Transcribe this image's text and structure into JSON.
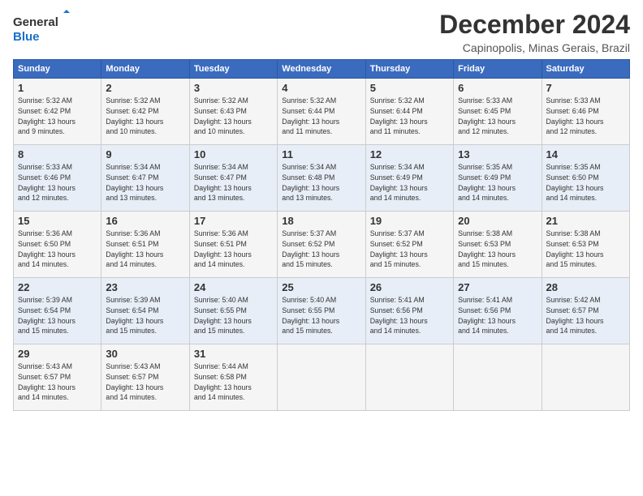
{
  "header": {
    "logo_line1": "General",
    "logo_line2": "Blue",
    "title": "December 2024",
    "subtitle": "Capinopolis, Minas Gerais, Brazil"
  },
  "weekdays": [
    "Sunday",
    "Monday",
    "Tuesday",
    "Wednesday",
    "Thursday",
    "Friday",
    "Saturday"
  ],
  "weeks": [
    [
      {
        "day": "1",
        "info": "Sunrise: 5:32 AM\nSunset: 6:42 PM\nDaylight: 13 hours\nand 9 minutes."
      },
      {
        "day": "2",
        "info": "Sunrise: 5:32 AM\nSunset: 6:42 PM\nDaylight: 13 hours\nand 10 minutes."
      },
      {
        "day": "3",
        "info": "Sunrise: 5:32 AM\nSunset: 6:43 PM\nDaylight: 13 hours\nand 10 minutes."
      },
      {
        "day": "4",
        "info": "Sunrise: 5:32 AM\nSunset: 6:44 PM\nDaylight: 13 hours\nand 11 minutes."
      },
      {
        "day": "5",
        "info": "Sunrise: 5:32 AM\nSunset: 6:44 PM\nDaylight: 13 hours\nand 11 minutes."
      },
      {
        "day": "6",
        "info": "Sunrise: 5:33 AM\nSunset: 6:45 PM\nDaylight: 13 hours\nand 12 minutes."
      },
      {
        "day": "7",
        "info": "Sunrise: 5:33 AM\nSunset: 6:46 PM\nDaylight: 13 hours\nand 12 minutes."
      }
    ],
    [
      {
        "day": "8",
        "info": "Sunrise: 5:33 AM\nSunset: 6:46 PM\nDaylight: 13 hours\nand 12 minutes."
      },
      {
        "day": "9",
        "info": "Sunrise: 5:34 AM\nSunset: 6:47 PM\nDaylight: 13 hours\nand 13 minutes."
      },
      {
        "day": "10",
        "info": "Sunrise: 5:34 AM\nSunset: 6:47 PM\nDaylight: 13 hours\nand 13 minutes."
      },
      {
        "day": "11",
        "info": "Sunrise: 5:34 AM\nSunset: 6:48 PM\nDaylight: 13 hours\nand 13 minutes."
      },
      {
        "day": "12",
        "info": "Sunrise: 5:34 AM\nSunset: 6:49 PM\nDaylight: 13 hours\nand 14 minutes."
      },
      {
        "day": "13",
        "info": "Sunrise: 5:35 AM\nSunset: 6:49 PM\nDaylight: 13 hours\nand 14 minutes."
      },
      {
        "day": "14",
        "info": "Sunrise: 5:35 AM\nSunset: 6:50 PM\nDaylight: 13 hours\nand 14 minutes."
      }
    ],
    [
      {
        "day": "15",
        "info": "Sunrise: 5:36 AM\nSunset: 6:50 PM\nDaylight: 13 hours\nand 14 minutes."
      },
      {
        "day": "16",
        "info": "Sunrise: 5:36 AM\nSunset: 6:51 PM\nDaylight: 13 hours\nand 14 minutes."
      },
      {
        "day": "17",
        "info": "Sunrise: 5:36 AM\nSunset: 6:51 PM\nDaylight: 13 hours\nand 14 minutes."
      },
      {
        "day": "18",
        "info": "Sunrise: 5:37 AM\nSunset: 6:52 PM\nDaylight: 13 hours\nand 15 minutes."
      },
      {
        "day": "19",
        "info": "Sunrise: 5:37 AM\nSunset: 6:52 PM\nDaylight: 13 hours\nand 15 minutes."
      },
      {
        "day": "20",
        "info": "Sunrise: 5:38 AM\nSunset: 6:53 PM\nDaylight: 13 hours\nand 15 minutes."
      },
      {
        "day": "21",
        "info": "Sunrise: 5:38 AM\nSunset: 6:53 PM\nDaylight: 13 hours\nand 15 minutes."
      }
    ],
    [
      {
        "day": "22",
        "info": "Sunrise: 5:39 AM\nSunset: 6:54 PM\nDaylight: 13 hours\nand 15 minutes."
      },
      {
        "day": "23",
        "info": "Sunrise: 5:39 AM\nSunset: 6:54 PM\nDaylight: 13 hours\nand 15 minutes."
      },
      {
        "day": "24",
        "info": "Sunrise: 5:40 AM\nSunset: 6:55 PM\nDaylight: 13 hours\nand 15 minutes."
      },
      {
        "day": "25",
        "info": "Sunrise: 5:40 AM\nSunset: 6:55 PM\nDaylight: 13 hours\nand 15 minutes."
      },
      {
        "day": "26",
        "info": "Sunrise: 5:41 AM\nSunset: 6:56 PM\nDaylight: 13 hours\nand 14 minutes."
      },
      {
        "day": "27",
        "info": "Sunrise: 5:41 AM\nSunset: 6:56 PM\nDaylight: 13 hours\nand 14 minutes."
      },
      {
        "day": "28",
        "info": "Sunrise: 5:42 AM\nSunset: 6:57 PM\nDaylight: 13 hours\nand 14 minutes."
      }
    ],
    [
      {
        "day": "29",
        "info": "Sunrise: 5:43 AM\nSunset: 6:57 PM\nDaylight: 13 hours\nand 14 minutes."
      },
      {
        "day": "30",
        "info": "Sunrise: 5:43 AM\nSunset: 6:57 PM\nDaylight: 13 hours\nand 14 minutes."
      },
      {
        "day": "31",
        "info": "Sunrise: 5:44 AM\nSunset: 6:58 PM\nDaylight: 13 hours\nand 14 minutes."
      },
      {
        "day": "",
        "info": ""
      },
      {
        "day": "",
        "info": ""
      },
      {
        "day": "",
        "info": ""
      },
      {
        "day": "",
        "info": ""
      }
    ]
  ]
}
